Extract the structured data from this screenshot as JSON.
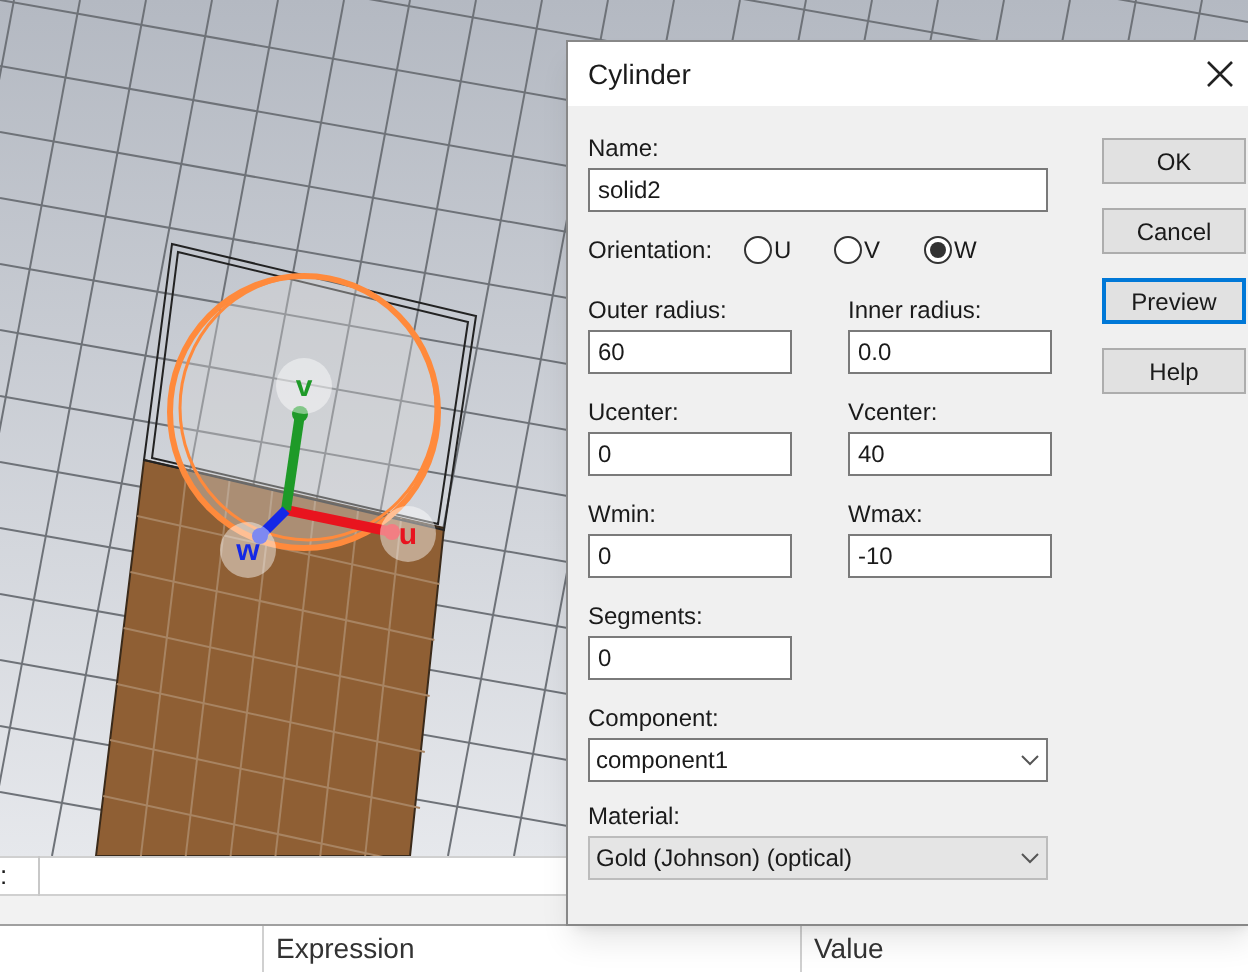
{
  "viewport": {
    "axis_labels": [
      {
        "label": "u",
        "color": "#e8141e"
      },
      {
        "label": "v",
        "color": "#1e9a28"
      },
      {
        "label": "w",
        "color": "#1428e6"
      }
    ]
  },
  "command_bar": {
    "label": ":"
  },
  "table": {
    "columns": [
      "Expression",
      "Value"
    ]
  },
  "dialog": {
    "title": "Cylinder",
    "rows": [
      {
        "kind": "wide_field",
        "fields": [
          {
            "label": "Name:",
            "value": "solid2"
          }
        ]
      },
      {
        "kind": "radio",
        "label": "Orientation:",
        "options": [
          {
            "label": "U",
            "selected": false
          },
          {
            "label": "V",
            "selected": false
          },
          {
            "label": "W",
            "selected": true
          }
        ]
      },
      {
        "kind": "fields",
        "fields": [
          {
            "label": "Outer radius:",
            "value": "60"
          },
          {
            "label": "Inner radius:",
            "value": "0.0"
          }
        ]
      },
      {
        "kind": "fields",
        "fields": [
          {
            "label": "Ucenter:",
            "value": "0"
          },
          {
            "label": "Vcenter:",
            "value": "40"
          }
        ]
      },
      {
        "kind": "fields",
        "fields": [
          {
            "label": "Wmin:",
            "value": "0"
          },
          {
            "label": "Wmax:",
            "value": "-10"
          }
        ]
      },
      {
        "kind": "fields",
        "fields": [
          {
            "label": "Segments:",
            "value": "0"
          }
        ]
      },
      {
        "kind": "select",
        "label": "Component:",
        "value": "component1",
        "disabled": false
      },
      {
        "kind": "select",
        "label": "Material:",
        "value": "Gold (Johnson) (optical)",
        "disabled": true
      }
    ],
    "buttons": [
      {
        "label": "OK",
        "focused": false
      },
      {
        "label": "Cancel",
        "focused": false
      },
      {
        "label": "Preview",
        "focused": true
      },
      {
        "label": "Help",
        "focused": false
      }
    ]
  }
}
